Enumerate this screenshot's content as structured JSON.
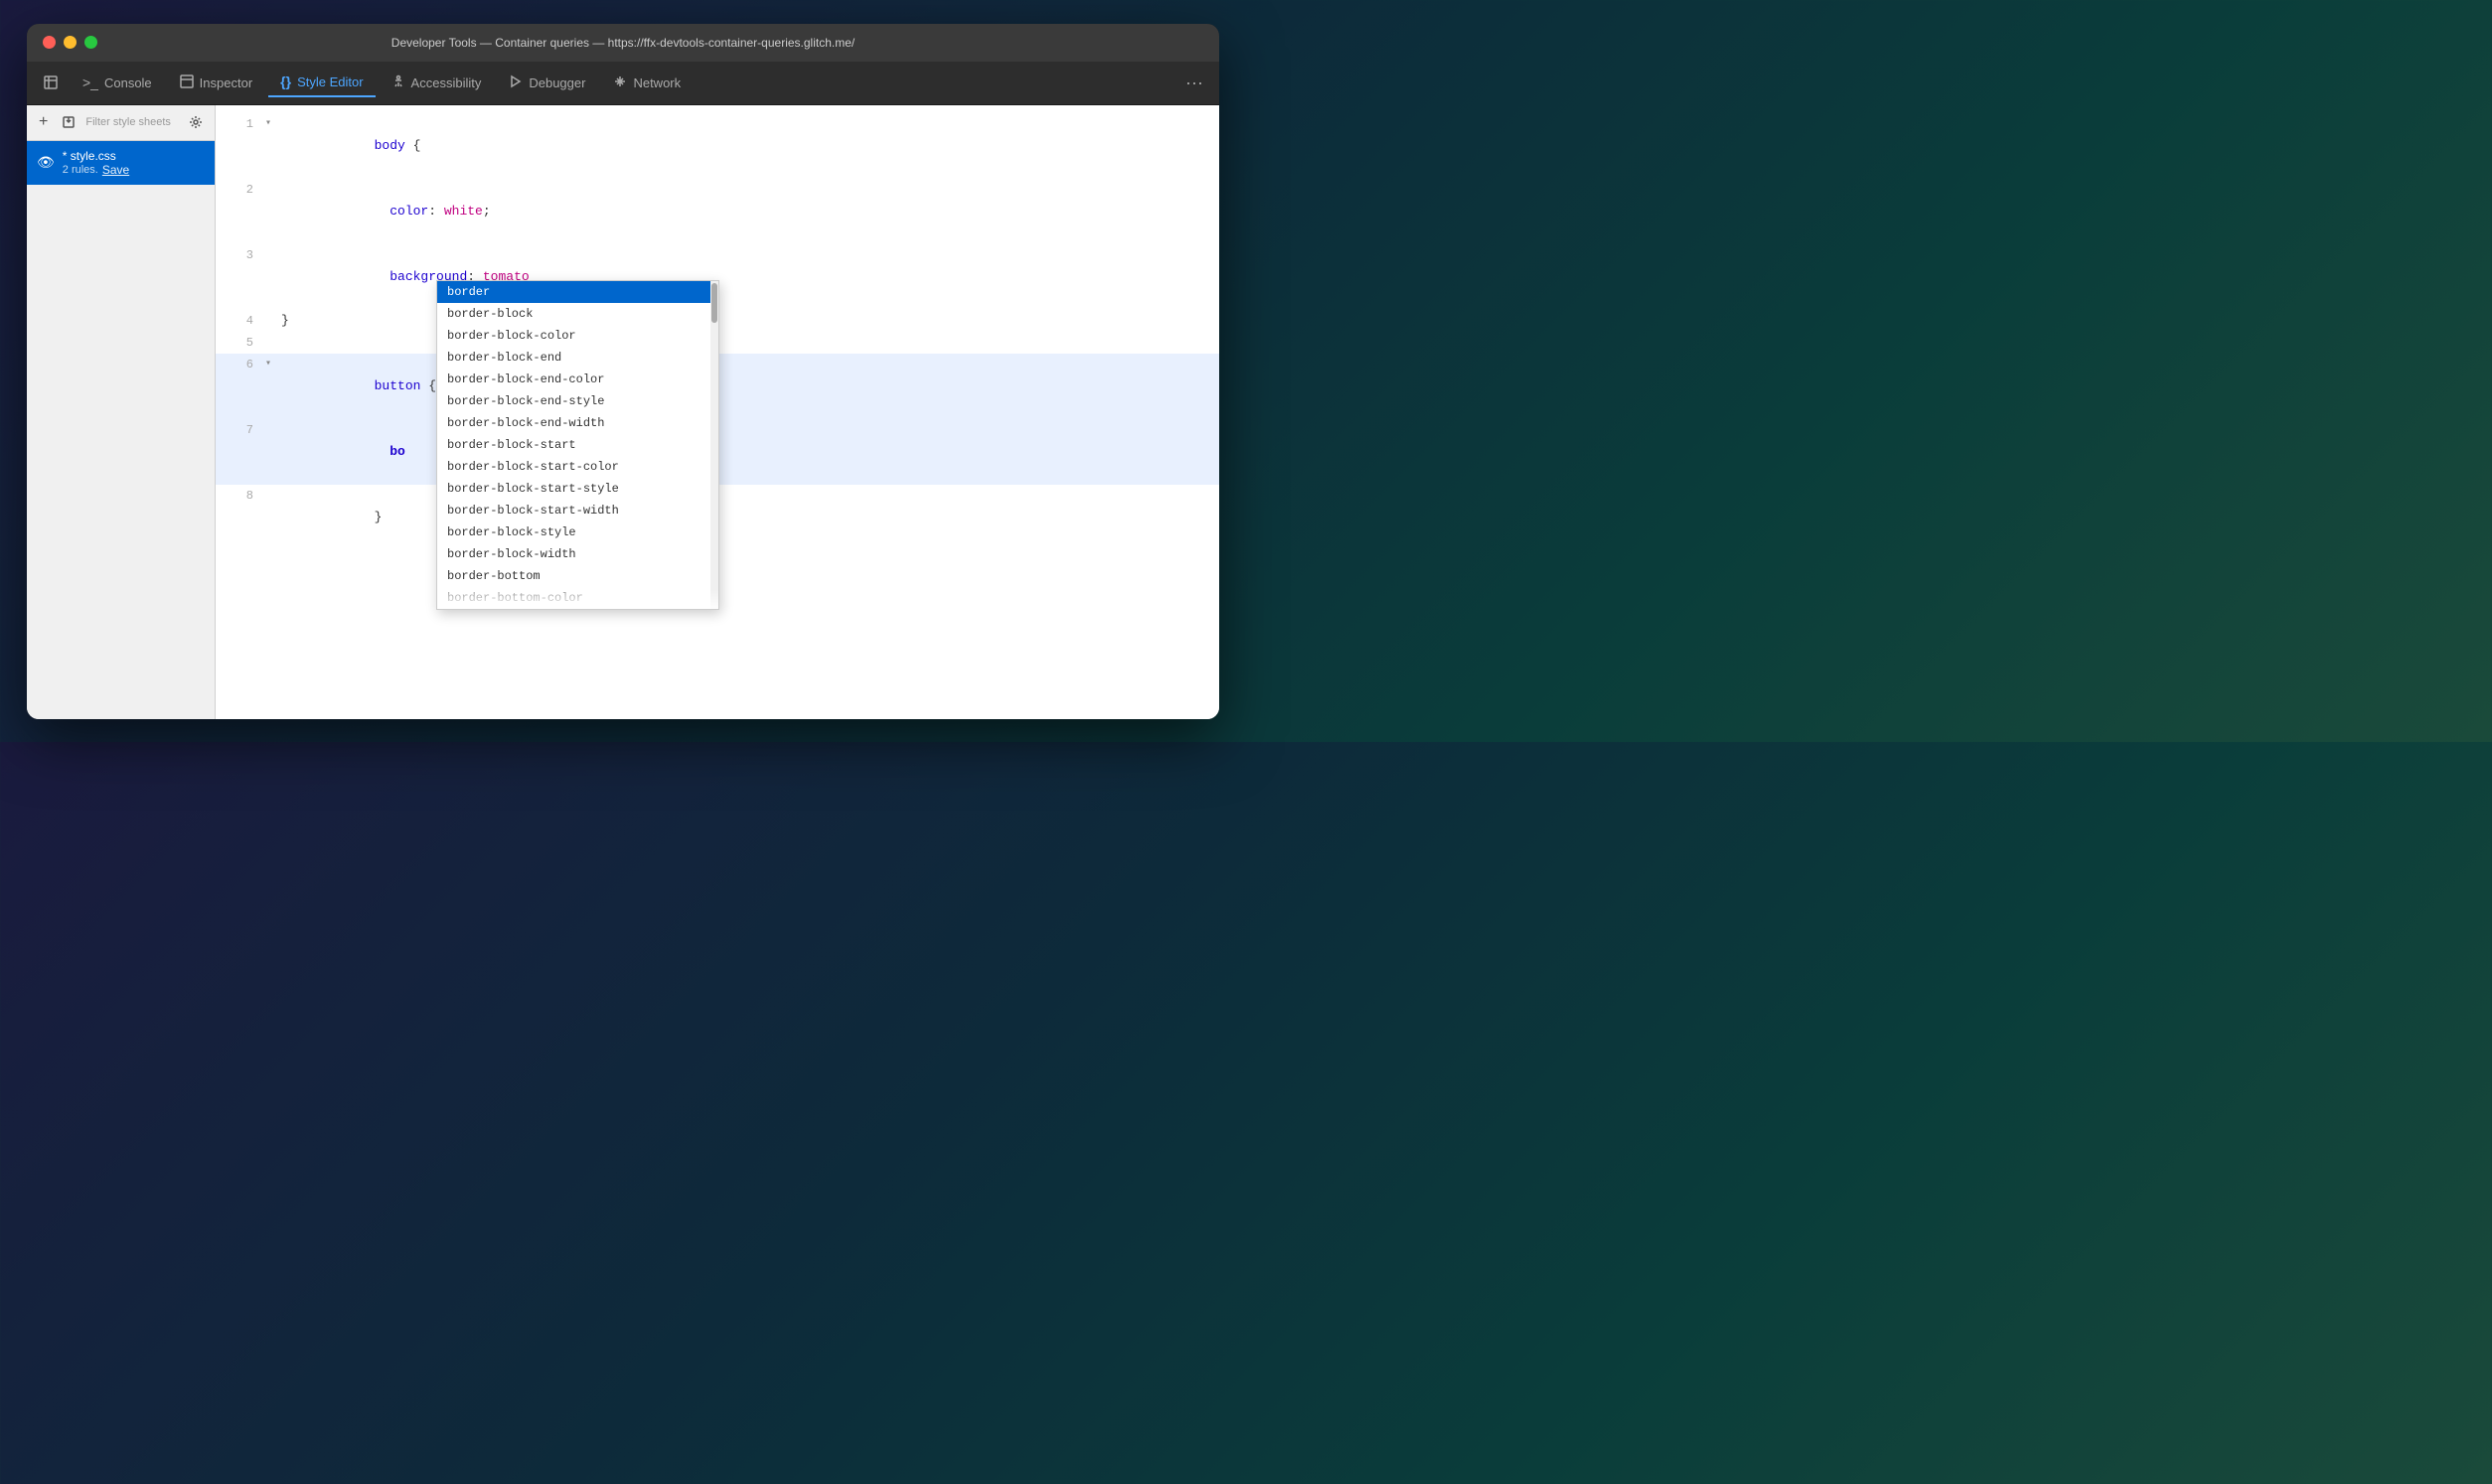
{
  "window": {
    "titlebar": {
      "title": "Developer Tools — Container queries — https://ffx-devtools-container-queries.glitch.me/"
    }
  },
  "toolbar": {
    "tabs": [
      {
        "id": "console",
        "label": "Console",
        "icon": "⬛",
        "active": false
      },
      {
        "id": "inspector",
        "label": "Inspector",
        "icon": "↖",
        "active": false
      },
      {
        "id": "style-editor",
        "label": "Style Editor",
        "icon": "{}",
        "active": true
      },
      {
        "id": "accessibility",
        "label": "Accessibility",
        "icon": "♿",
        "active": false
      },
      {
        "id": "debugger",
        "label": "Debugger",
        "icon": "▷",
        "active": false
      },
      {
        "id": "network",
        "label": "Network",
        "icon": "↕",
        "active": false
      }
    ],
    "more_label": "···"
  },
  "sidebar": {
    "toolbar": {
      "add_btn": "+",
      "import_btn": "⬆",
      "filter_placeholder": "Filter style sheets",
      "settings_icon": "⚙"
    },
    "files": [
      {
        "id": "style-css",
        "eye_icon": "👁",
        "name": "* style.css",
        "rules": "2 rules.",
        "save_label": "Save",
        "selected": true
      }
    ]
  },
  "editor": {
    "lines": [
      {
        "num": "1",
        "arrow": "▾",
        "content": "body {",
        "type": "selector"
      },
      {
        "num": "2",
        "arrow": "",
        "content": "  color: white;",
        "type": "property"
      },
      {
        "num": "3",
        "arrow": "",
        "content": "  background: tomato",
        "type": "property"
      },
      {
        "num": "4",
        "arrow": "",
        "content": "}",
        "type": "brace"
      },
      {
        "num": "5",
        "arrow": "",
        "content": "",
        "type": "empty"
      },
      {
        "num": "6",
        "arrow": "▾",
        "content": "button {",
        "type": "selector",
        "highlighted": true
      },
      {
        "num": "7",
        "arrow": "",
        "content": "  bo",
        "type": "typing",
        "highlighted": true
      },
      {
        "num": "8",
        "arrow": "",
        "content": "}",
        "type": "brace"
      }
    ]
  },
  "autocomplete": {
    "items": [
      {
        "label": "border",
        "selected": true
      },
      {
        "label": "border-block",
        "selected": false
      },
      {
        "label": "border-block-color",
        "selected": false
      },
      {
        "label": "border-block-end",
        "selected": false
      },
      {
        "label": "border-block-end-color",
        "selected": false
      },
      {
        "label": "border-block-end-style",
        "selected": false
      },
      {
        "label": "border-block-end-width",
        "selected": false
      },
      {
        "label": "border-block-start",
        "selected": false
      },
      {
        "label": "border-block-start-color",
        "selected": false
      },
      {
        "label": "border-block-start-style",
        "selected": false
      },
      {
        "label": "border-block-start-width",
        "selected": false
      },
      {
        "label": "border-block-style",
        "selected": false
      },
      {
        "label": "border-block-width",
        "selected": false
      },
      {
        "label": "border-bottom",
        "selected": false
      },
      {
        "label": "border-bottom-color",
        "selected": false
      }
    ]
  }
}
